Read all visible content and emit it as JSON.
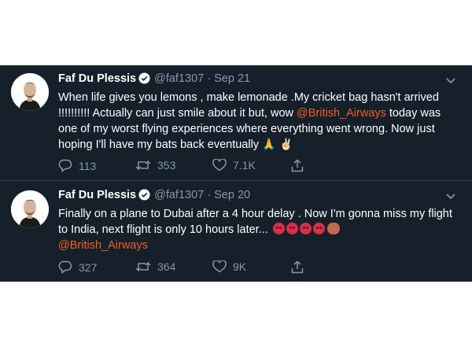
{
  "tweets": [
    {
      "name": "Faf Du Plessis",
      "handle": "@faf1307",
      "separator": "·",
      "date": "Sep 21",
      "text_before": "When life gives you lemons , make lemonade .My cricket bag hasn't arrived !!!!!!!!!! Actually can just smile about it but, wow ",
      "mention": "@British_Airways",
      "text_after": " today was one of my worst flying experiences where everything went wrong. Now just hoping I'll have my bats back eventually ",
      "emojis": "🙏 ✌🏻",
      "replies": "113",
      "retweets": "353",
      "likes": "7.1K"
    },
    {
      "name": "Faf Du Plessis",
      "handle": "@faf1307",
      "separator": "·",
      "date": "Sep 20",
      "text_before": "Finally on a plane to Dubai after a 4 hour delay . Now I'm gonna miss my flight to India, next flight is only 10 hours later... ",
      "mention": "@British_Airways",
      "replies": "327",
      "retweets": "364",
      "likes": "9K"
    }
  ],
  "icons": {
    "verified": "verified-badge-icon",
    "chevron": "chevron-down-icon",
    "reply": "reply-icon",
    "retweet": "retweet-icon",
    "like": "heart-icon",
    "share": "share-icon"
  },
  "colors": {
    "background": "#15202b",
    "text": "#ffffff",
    "muted": "#8899a6",
    "mention": "#f45d22"
  }
}
